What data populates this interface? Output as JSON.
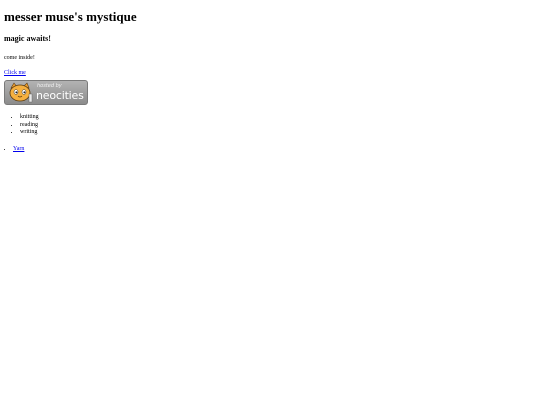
{
  "page": {
    "title": "messer muse's mystique",
    "subtitle": "magic awaits!",
    "tagline": "come inside!",
    "click_link": "Click me"
  },
  "badge": {
    "hosted_label": "hosted by",
    "brand": "neocities"
  },
  "hobbies": [
    "knitting",
    "reading",
    "writing"
  ],
  "links": [
    "Yarn"
  ]
}
